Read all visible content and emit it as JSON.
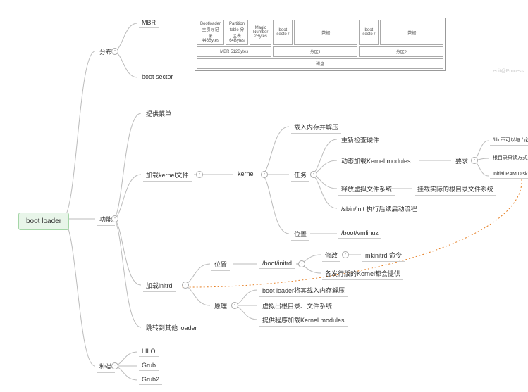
{
  "root": {
    "label": "boot loader"
  },
  "dist": {
    "label": "分布",
    "mbr": "MBR",
    "bootsector": "boot sector"
  },
  "table": {
    "h0": "Bootloader\n主引导记录\n446Bytes",
    "h1": "Partition\ntable\n分区表\n64Bytes",
    "h2": "Magic\nNumber\n2Bytes",
    "h3": "boot\nsecto\nr",
    "h4": "数据",
    "h5": "boot\nsecto\nr",
    "h6": "数据",
    "r2a": "MBR    512Bytes",
    "r2b": "分区1",
    "r2c": "分区2",
    "r3": "磁盘",
    "watermark": "edit@Process"
  },
  "func": {
    "label": "功能",
    "menu": "提供菜单",
    "loadk": "加载kernel文件",
    "loadi": "加载initrd",
    "jump": "跳转到其他 loader"
  },
  "kernel": {
    "label": "kernel",
    "load": "载入内存并解压",
    "task": "任务",
    "t1": "重新检查硬件",
    "t2": "动态加载Kernel modules",
    "t3": "释放虚拟文件系统",
    "t3b": "挂载实际的根目录文件系统",
    "t4": "/sbin/init 执行后续启动流程",
    "req": "要求",
    "r1": "/lib 不可以与 / 必须同一partion",
    "r2": "根目录只读方式挂载",
    "r3": "Initial RAM Disk",
    "loc": "位置",
    "locv": "/boot/vmlinuz"
  },
  "initrd": {
    "loc": "位置",
    "locv": "/boot/initrd",
    "mod": "修改",
    "modv": "mkinitrd 命令",
    "dist": "各发行版的Kernel都会提供",
    "princ": "原理",
    "p1": "boot loader将其载入内存解压",
    "p2": "虚拟出根目录、文件系统",
    "p3": "提供程序加载Kernel modules"
  },
  "kinds": {
    "label": "种类",
    "k1": "LILO",
    "k2": "Grub",
    "k3": "Grub2"
  }
}
